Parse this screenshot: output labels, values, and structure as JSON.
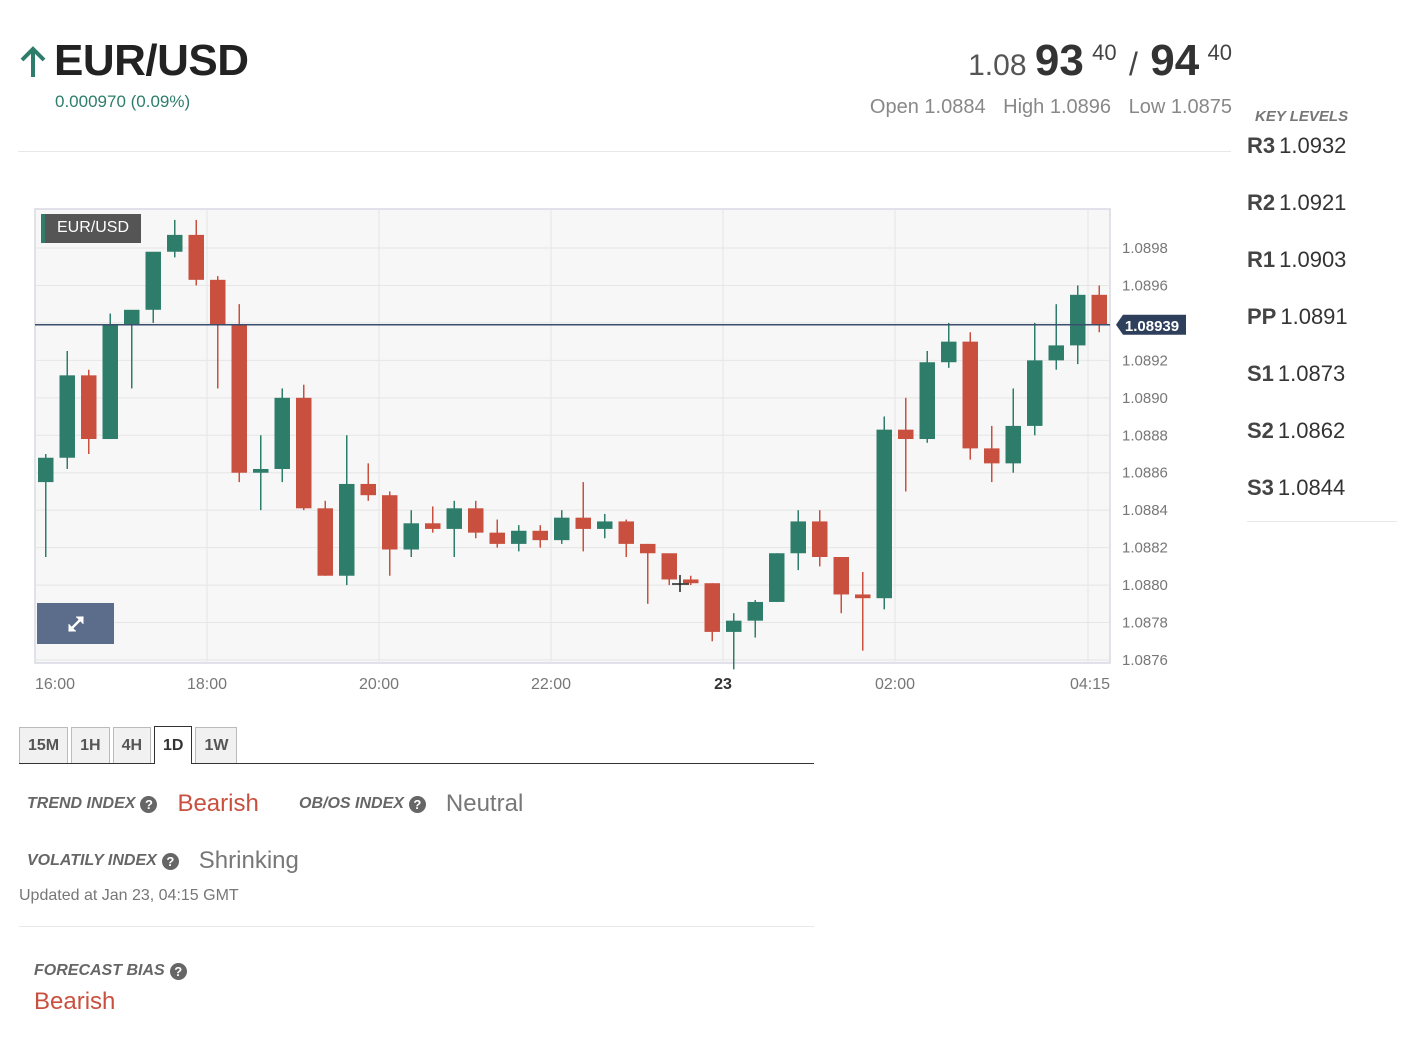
{
  "header": {
    "pair": "EUR/USD",
    "change": "0.000970 (0.09%)",
    "bid_prefix": "1.08",
    "bid_big": "93",
    "bid_sup": "40",
    "separator": "/",
    "ask_big": "94",
    "ask_sup": "40",
    "open": "Open 1.0884",
    "high": "High 1.0896",
    "low": "Low 1.0875",
    "colors": {
      "up": "#2e7d6b",
      "down": "#c9503f"
    }
  },
  "key_levels": {
    "title": "KEY LEVELS",
    "items": [
      {
        "name": "R3",
        "value": "1.0932"
      },
      {
        "name": "R2",
        "value": "1.0921"
      },
      {
        "name": "R1",
        "value": "1.0903"
      },
      {
        "name": "PP",
        "value": "1.0891"
      },
      {
        "name": "S1",
        "value": "1.0873"
      },
      {
        "name": "S2",
        "value": "1.0862"
      },
      {
        "name": "S3",
        "value": "1.0844"
      }
    ]
  },
  "chart": {
    "label": "EUR/USD",
    "expand_icon": "expand-icon"
  },
  "chart_data": {
    "type": "candlestick",
    "ylim": [
      1.0875,
      1.09
    ],
    "y_ticks": [
      "1.0898",
      "1.0896",
      "1.0892",
      "1.0890",
      "1.0888",
      "1.0886",
      "1.0884",
      "1.0882",
      "1.0880",
      "1.0878",
      "1.0876"
    ],
    "y_tick_values": [
      1.0898,
      1.0896,
      1.0892,
      1.089,
      1.0888,
      1.0886,
      1.0884,
      1.0882,
      1.088,
      1.0878,
      1.0876
    ],
    "x_ticks": [
      "16:00",
      "18:00",
      "20:00",
      "22:00",
      "23",
      "02:00",
      "04:15"
    ],
    "x_tick_bold": [
      false,
      false,
      false,
      false,
      true,
      false,
      false
    ],
    "x_tick_index": [
      0.5,
      8,
      16,
      24,
      32,
      40,
      48
    ],
    "current_price": {
      "value": 1.08939,
      "label": "1.08939"
    },
    "candles": [
      {
        "o": 1.08855,
        "h": 1.0887,
        "l": 1.08815,
        "c": 1.08868
      },
      {
        "o": 1.08868,
        "h": 1.08925,
        "l": 1.08862,
        "c": 1.08912
      },
      {
        "o": 1.08912,
        "h": 1.08915,
        "l": 1.0887,
        "c": 1.08878
      },
      {
        "o": 1.08878,
        "h": 1.08945,
        "l": 1.08878,
        "c": 1.08939
      },
      {
        "o": 1.08939,
        "h": 1.08945,
        "l": 1.08905,
        "c": 1.08947
      },
      {
        "o": 1.08947,
        "h": 1.08972,
        "l": 1.0894,
        "c": 1.08978
      },
      {
        "o": 1.08978,
        "h": 1.08995,
        "l": 1.08975,
        "c": 1.08987
      },
      {
        "o": 1.08987,
        "h": 1.08995,
        "l": 1.0896,
        "c": 1.08963
      },
      {
        "o": 1.08963,
        "h": 1.08965,
        "l": 1.08905,
        "c": 1.08939
      },
      {
        "o": 1.08939,
        "h": 1.0895,
        "l": 1.08855,
        "c": 1.0886
      },
      {
        "o": 1.0886,
        "h": 1.0888,
        "l": 1.0884,
        "c": 1.08862
      },
      {
        "o": 1.08862,
        "h": 1.08905,
        "l": 1.08855,
        "c": 1.089
      },
      {
        "o": 1.089,
        "h": 1.08907,
        "l": 1.0884,
        "c": 1.08841
      },
      {
        "o": 1.08841,
        "h": 1.08845,
        "l": 1.08805,
        "c": 1.08805
      },
      {
        "o": 1.08805,
        "h": 1.0888,
        "l": 1.088,
        "c": 1.08854
      },
      {
        "o": 1.08854,
        "h": 1.08865,
        "l": 1.08845,
        "c": 1.08848
      },
      {
        "o": 1.08848,
        "h": 1.0885,
        "l": 1.08805,
        "c": 1.08819
      },
      {
        "o": 1.08819,
        "h": 1.0884,
        "l": 1.08815,
        "c": 1.08833
      },
      {
        "o": 1.08833,
        "h": 1.08842,
        "l": 1.08828,
        "c": 1.0883
      },
      {
        "o": 1.0883,
        "h": 1.08845,
        "l": 1.08815,
        "c": 1.08841
      },
      {
        "o": 1.08841,
        "h": 1.08845,
        "l": 1.08825,
        "c": 1.08828
      },
      {
        "o": 1.08828,
        "h": 1.08835,
        "l": 1.0882,
        "c": 1.08822
      },
      {
        "o": 1.08822,
        "h": 1.08832,
        "l": 1.08818,
        "c": 1.08829
      },
      {
        "o": 1.08829,
        "h": 1.08832,
        "l": 1.0882,
        "c": 1.08824
      },
      {
        "o": 1.08824,
        "h": 1.0884,
        "l": 1.08822,
        "c": 1.08836
      },
      {
        "o": 1.08836,
        "h": 1.08855,
        "l": 1.08818,
        "c": 1.0883
      },
      {
        "o": 1.0883,
        "h": 1.08838,
        "l": 1.08825,
        "c": 1.08834
      },
      {
        "o": 1.08834,
        "h": 1.08835,
        "l": 1.08815,
        "c": 1.08822
      },
      {
        "o": 1.08822,
        "h": 1.08822,
        "l": 1.0879,
        "c": 1.08817
      },
      {
        "o": 1.08817,
        "h": 1.08815,
        "l": 1.088,
        "c": 1.08803
      },
      {
        "o": 1.08803,
        "h": 1.08805,
        "l": 1.088,
        "c": 1.08801
      },
      {
        "o": 1.08801,
        "h": 1.08801,
        "l": 1.0877,
        "c": 1.08775
      },
      {
        "o": 1.08775,
        "h": 1.08785,
        "l": 1.08755,
        "c": 1.08781
      },
      {
        "o": 1.08781,
        "h": 1.08792,
        "l": 1.08772,
        "c": 1.08791
      },
      {
        "o": 1.08791,
        "h": 1.08817,
        "l": 1.08791,
        "c": 1.08817
      },
      {
        "o": 1.08817,
        "h": 1.0884,
        "l": 1.08808,
        "c": 1.08834
      },
      {
        "o": 1.08834,
        "h": 1.0884,
        "l": 1.0881,
        "c": 1.08815
      },
      {
        "o": 1.08815,
        "h": 1.08815,
        "l": 1.08785,
        "c": 1.08795
      },
      {
        "o": 1.08795,
        "h": 1.08807,
        "l": 1.08765,
        "c": 1.08793
      },
      {
        "o": 1.08793,
        "h": 1.0889,
        "l": 1.08787,
        "c": 1.08883
      },
      {
        "o": 1.08883,
        "h": 1.089,
        "l": 1.0885,
        "c": 1.08878
      },
      {
        "o": 1.08878,
        "h": 1.08925,
        "l": 1.08876,
        "c": 1.08919
      },
      {
        "o": 1.08919,
        "h": 1.0894,
        "l": 1.08916,
        "c": 1.0893
      },
      {
        "o": 1.0893,
        "h": 1.08935,
        "l": 1.08867,
        "c": 1.08873
      },
      {
        "o": 1.08873,
        "h": 1.08885,
        "l": 1.08855,
        "c": 1.08865
      },
      {
        "o": 1.08865,
        "h": 1.08905,
        "l": 1.0886,
        "c": 1.08885
      },
      {
        "o": 1.08885,
        "h": 1.0894,
        "l": 1.0888,
        "c": 1.0892
      },
      {
        "o": 1.0892,
        "h": 1.0895,
        "l": 1.08915,
        "c": 1.08928
      },
      {
        "o": 1.08928,
        "h": 1.0896,
        "l": 1.08918,
        "c": 1.08955
      },
      {
        "o": 1.08955,
        "h": 1.0896,
        "l": 1.08935,
        "c": 1.08939
      }
    ]
  },
  "tabs": [
    "15M",
    "1H",
    "4H",
    "1D",
    "1W"
  ],
  "active_tab_index": 3,
  "indexes": {
    "trend_label": "TREND INDEX",
    "trend_value": "Bearish",
    "obos_label": "OB/OS INDEX",
    "obos_value": "Neutral",
    "volatility_label": "VOLATILY INDEX",
    "volatility_value": "Shrinking",
    "help_glyph": "?"
  },
  "updated": "Updated at Jan 23, 04:15 GMT",
  "forecast": {
    "label": "FORECAST BIAS",
    "value": "Bearish"
  }
}
